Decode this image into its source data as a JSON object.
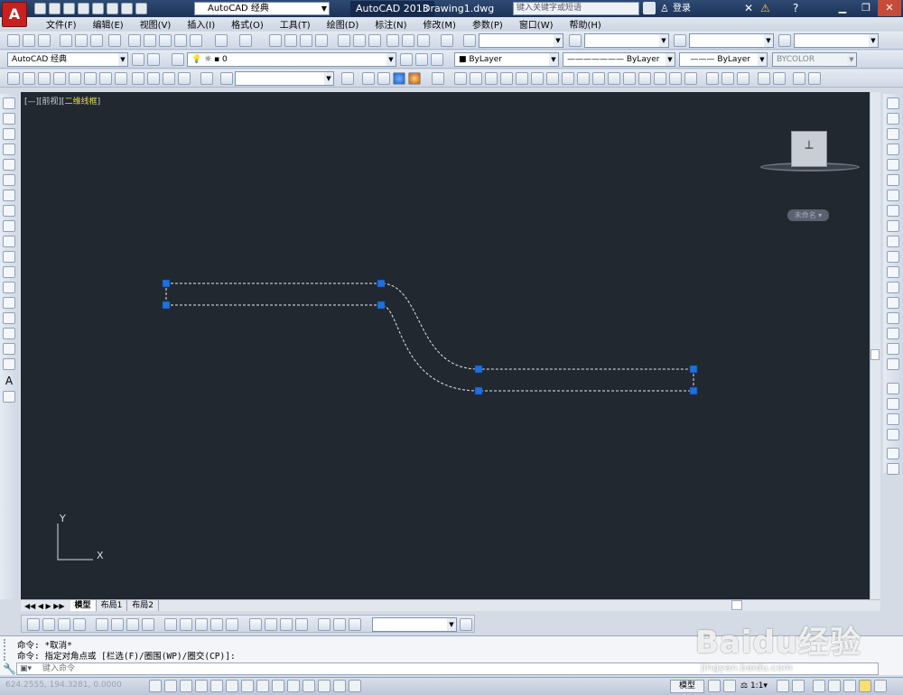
{
  "app": {
    "workspace": "AutoCAD 经典",
    "product": "AutoCAD 2013",
    "document": "Drawing1.dwg",
    "search_placeholder": "键入关键字或短语",
    "login": "登录"
  },
  "menu": [
    "文件(F)",
    "编辑(E)",
    "视图(V)",
    "插入(I)",
    "格式(O)",
    "工具(T)",
    "绘图(D)",
    "标注(N)",
    "修改(M)",
    "参数(P)",
    "窗口(W)",
    "帮助(H)"
  ],
  "toolbar2": {
    "workspace": "AutoCAD 经典",
    "layer": "0",
    "color": "ByLayer",
    "linetype": "ByLayer",
    "lineweight": "ByLayer",
    "plotstyle": "BYCOLOR"
  },
  "viewport": {
    "label_prefix": "[—][前视][",
    "label_style": "二维线框",
    "label_suffix": "]",
    "wcs": "未命名",
    "ucs_y": "Y",
    "ucs_x": "X"
  },
  "tabs": [
    "模型",
    "布局1",
    "布局2"
  ],
  "command": {
    "line1": "命令: *取消*",
    "line2": "命令: 指定对角点或 [栏选(F)/圈围(WP)/圈交(CP)]:",
    "input_placeholder": "键入命令"
  },
  "status": {
    "coords": "624.2555, 194.3281, 0.0000",
    "model": "模型",
    "scale": "1:1"
  },
  "watermark": {
    "brand": "Baidu经验",
    "url": "jingyan.baidu.com"
  },
  "colors": {
    "canvas": "#212830",
    "grip": "#1f6fe0",
    "selection": "#e6e6e6"
  }
}
